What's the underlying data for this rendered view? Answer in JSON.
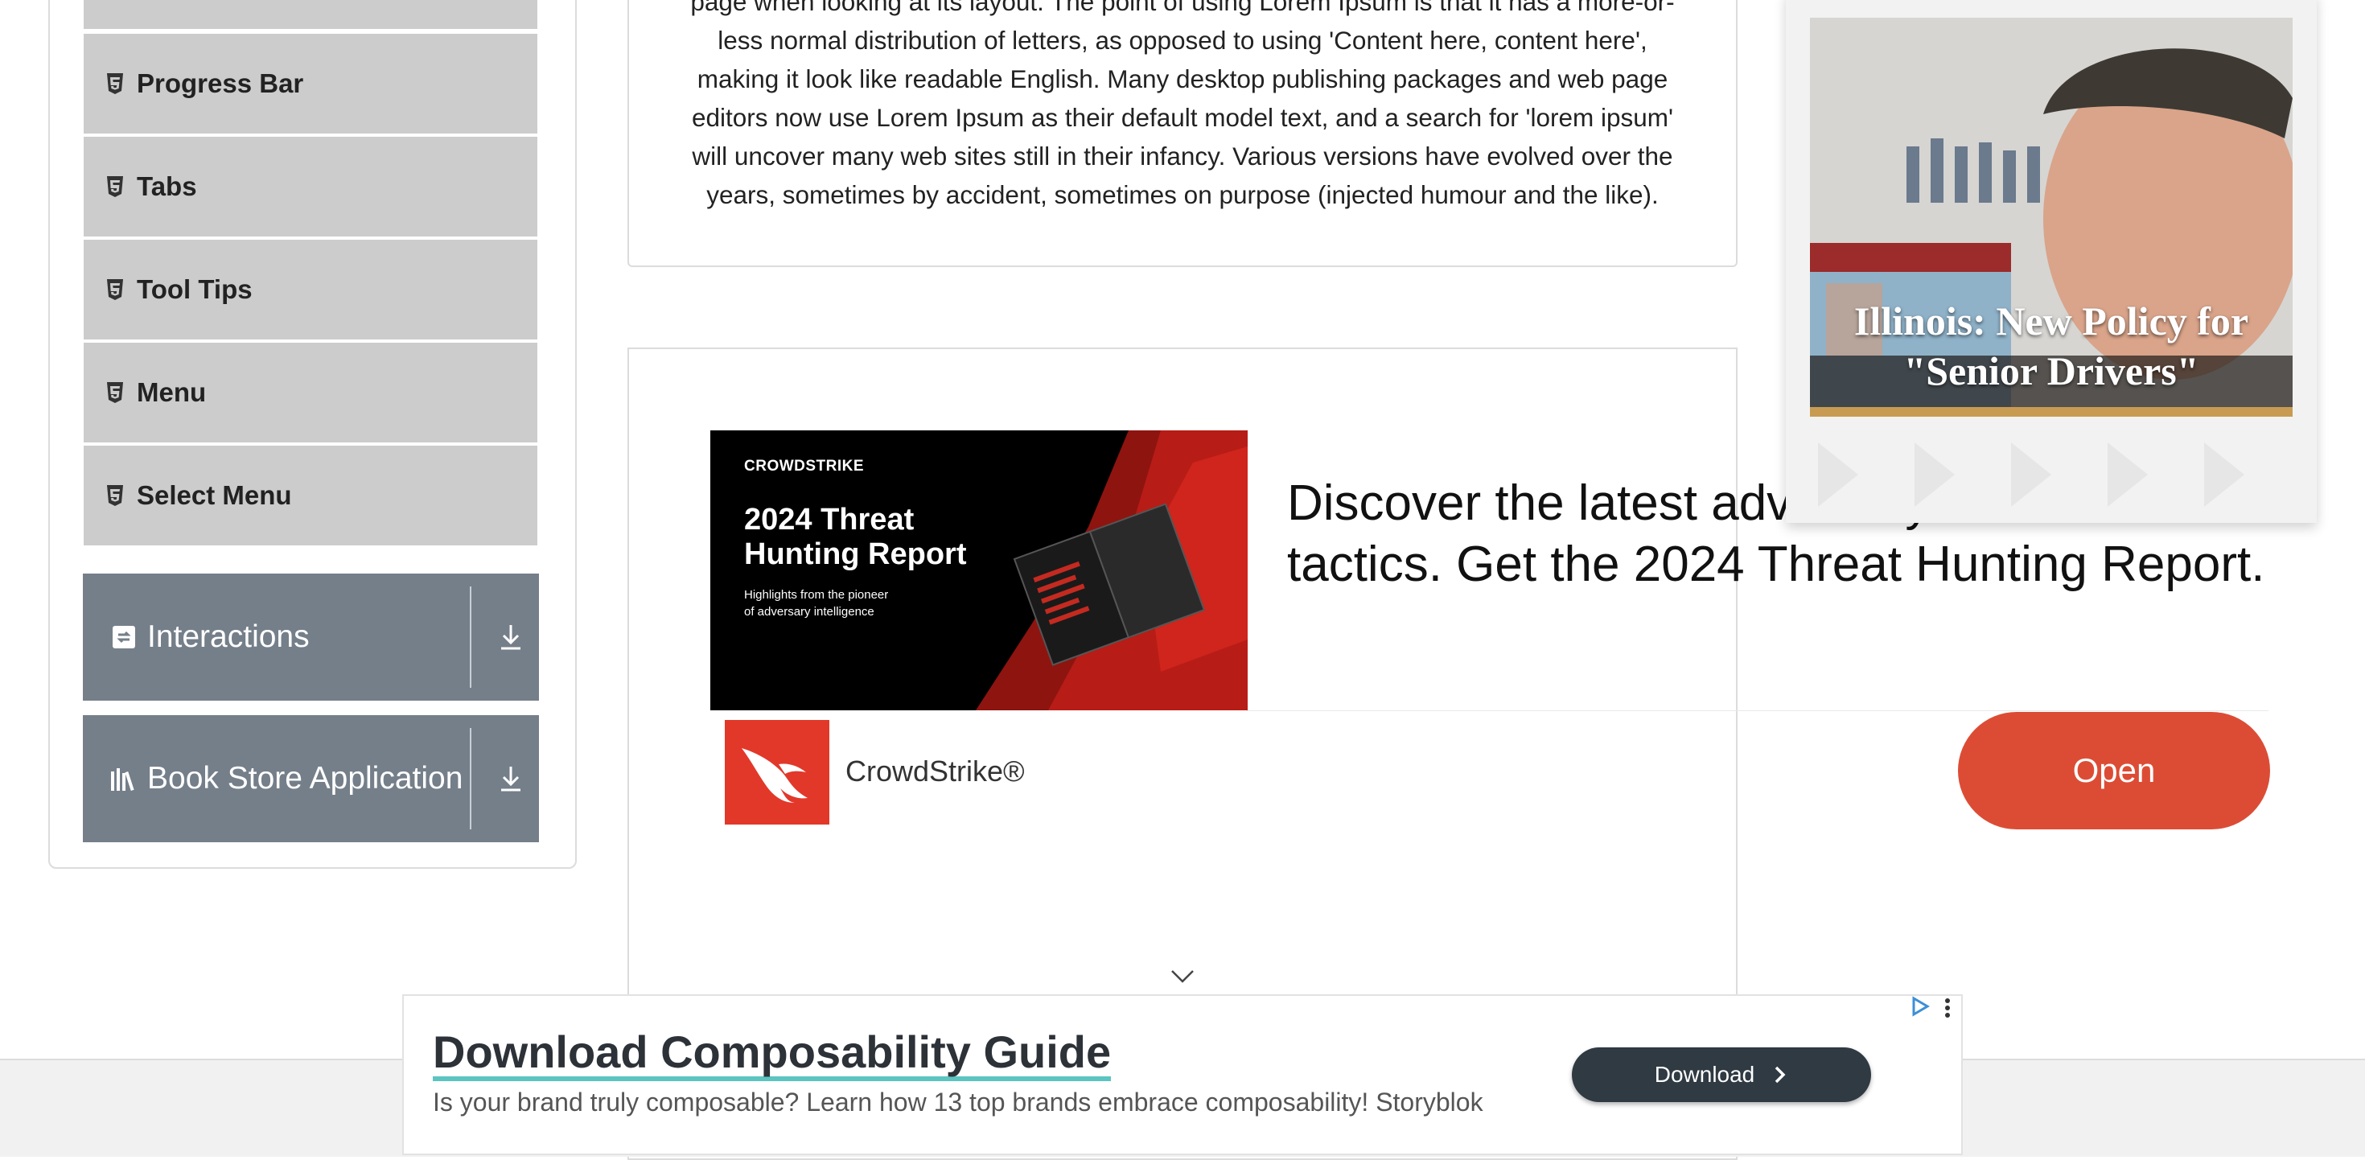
{
  "sidebar": {
    "items": [
      {
        "label": "Progress Bar"
      },
      {
        "label": "Tabs"
      },
      {
        "label": "Tool Tips"
      },
      {
        "label": "Menu"
      },
      {
        "label": "Select Menu"
      }
    ],
    "groups": [
      {
        "label": "Interactions",
        "icon": "interactions-icon"
      },
      {
        "label": "Book Store Application",
        "icon": "bookstore-icon"
      }
    ]
  },
  "article": {
    "lines": [
      "page when looking at its layout. The point of using Lorem Ipsum is that it has a more-or-",
      "less normal distribution of letters, as opposed to using 'Content here, content here',",
      "making it look like readable English. Many desktop publishing packages and web page",
      "editors now use Lorem Ipsum as their default model text, and a search for 'lorem ipsum'",
      "will uncover many web sites still in their infancy. Various versions have evolved over the",
      "years, sometimes by accident, sometimes on purpose (injected humour and the like)."
    ]
  },
  "crowdstrike_ad": {
    "logo_text": "CROWDSTRIKE",
    "banner_title_1": "2024 Threat",
    "banner_title_2": "Hunting Report",
    "banner_sub_1": "Highlights from the pioneer",
    "banner_sub_2": "of adversary intelligence",
    "headline": "Discover the latest adversary trends and tactics. Get the 2024 Threat Hunting Report.",
    "brand_name": "CrowdStrike®",
    "open_label": "Open",
    "accent": "#dc4c35"
  },
  "popup": {
    "caption_1": "Illinois: New Policy for",
    "caption_2": "\"Senior Drivers\""
  },
  "bottom_ad": {
    "title": "Download Composability Guide",
    "description": "Is your brand truly composable? Learn how 13 top brands embrace composability! Storyblok",
    "button_label": "Download"
  }
}
